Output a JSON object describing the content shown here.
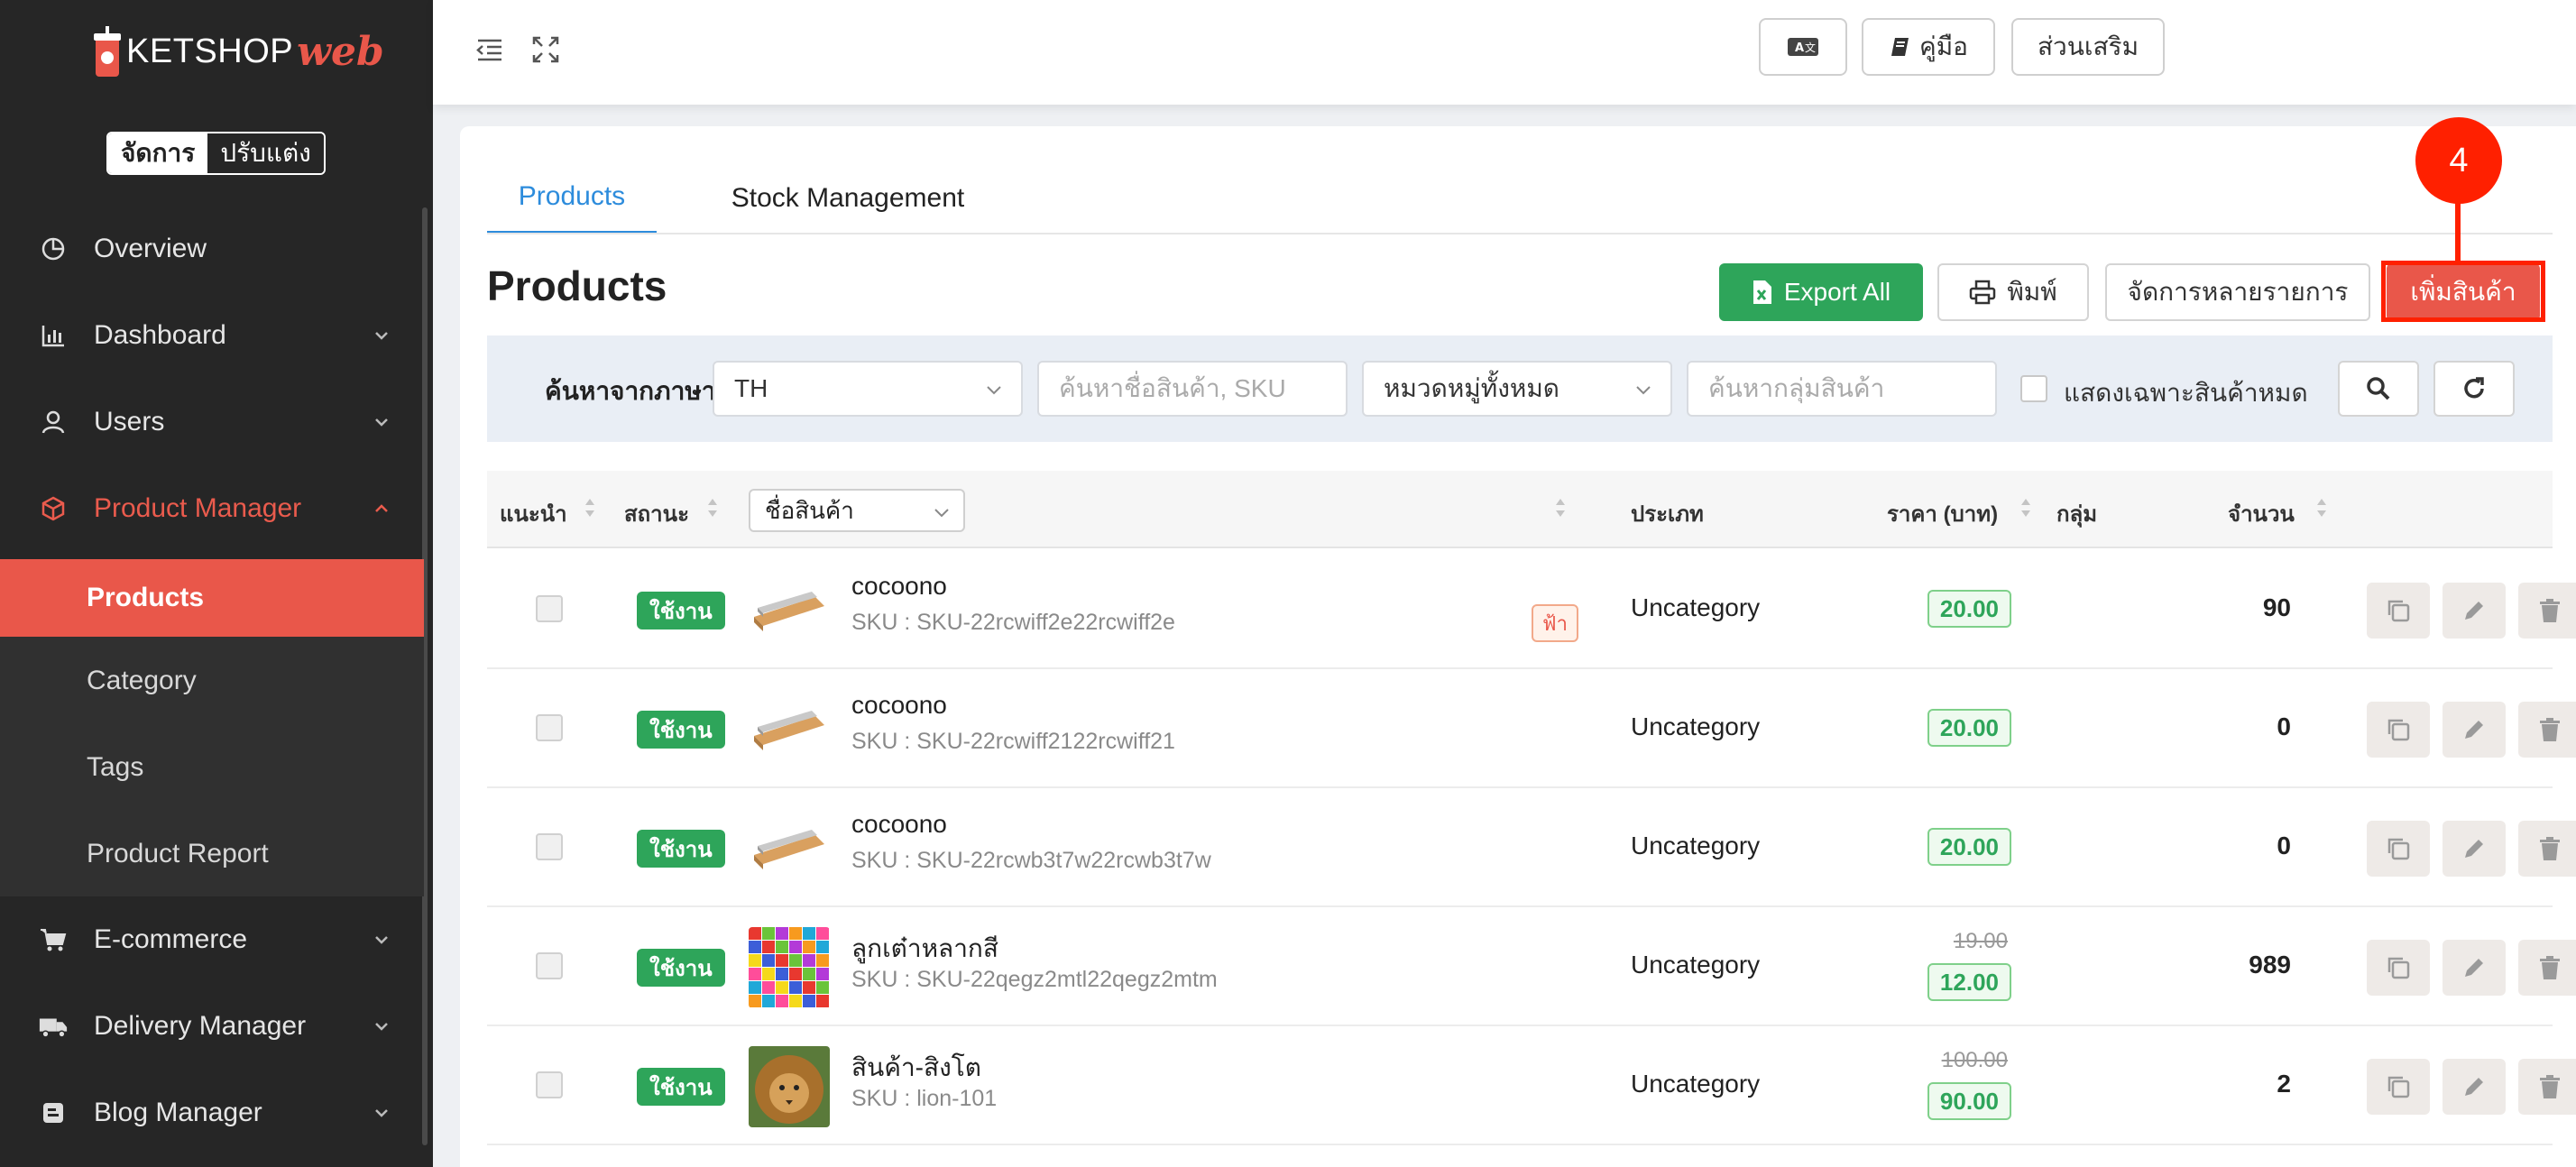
{
  "brand": {
    "name": "KETSHOP",
    "suffix": "web"
  },
  "mode": {
    "active": "จัดการ",
    "inactive": "ปรับแต่ง"
  },
  "nav": [
    {
      "label": "Overview",
      "icon": "pie-chart-icon"
    },
    {
      "label": "Dashboard",
      "icon": "bar-chart-icon"
    },
    {
      "label": "Users",
      "icon": "user-icon"
    },
    {
      "label": "Product Manager",
      "icon": "box-icon"
    },
    {
      "label": "E-commerce",
      "icon": "cart-icon"
    },
    {
      "label": "Delivery Manager",
      "icon": "truck-icon"
    },
    {
      "label": "Blog Manager",
      "icon": "blog-icon"
    }
  ],
  "subnav": [
    "Products",
    "Category",
    "Tags",
    "Product Report"
  ],
  "topbar": {
    "translate_icon": "translate-icon",
    "manual": "คู่มือ",
    "addons": "ส่วนเสริม"
  },
  "tabs": [
    "Products",
    "Stock Management"
  ],
  "page_title": "Products",
  "actions": {
    "export": "Export All",
    "print": "พิมพ์",
    "bulk": "จัดการหลายรายการ",
    "add": "เพิ่มสินค้า"
  },
  "step_badge": "4",
  "filter": {
    "label": "ค้นหาจากภาษา",
    "language": "TH",
    "search_placeholder": "ค้นหาชื่อสินค้า, SKU",
    "category": "หมวดหมู่ทั้งหมด",
    "group_placeholder": "ค้นหากลุ่มสินค้า",
    "out_of_stock": "แสดงเฉพาะสินค้าหมด"
  },
  "columns": {
    "recommend": "แนะนำ",
    "status": "สถานะ",
    "name": "ชื่อสินค้า",
    "type": "ประเภท",
    "price": "ราคา (บาท)",
    "group": "กลุ่ม",
    "qty": "จำนวน"
  },
  "rows": [
    {
      "status": "ใช้งาน",
      "name": "cocoono",
      "sku": "SKU : SKU-22rcwiff2e22rcwiff2e",
      "tag": "ฟ้า",
      "type": "Uncategory",
      "old_price": "",
      "price": "20.00",
      "qty": "90",
      "thumb": "wood"
    },
    {
      "status": "ใช้งาน",
      "name": "cocoono",
      "sku": "SKU : SKU-22rcwiff2122rcwiff21",
      "tag": "",
      "type": "Uncategory",
      "old_price": "",
      "price": "20.00",
      "qty": "0",
      "thumb": "wood"
    },
    {
      "status": "ใช้งาน",
      "name": "cocoono",
      "sku": "SKU : SKU-22rcwb3t7w22rcwb3t7w",
      "tag": "",
      "type": "Uncategory",
      "old_price": "",
      "price": "20.00",
      "qty": "0",
      "thumb": "wood"
    },
    {
      "status": "ใช้งาน",
      "name": "ลูกเต๋าหลากสี",
      "sku": "SKU : SKU-22qegz2mtl22qegz2mtm",
      "tag": "",
      "type": "Uncategory",
      "old_price": "19.00",
      "price": "12.00",
      "qty": "989",
      "thumb": "cubes"
    },
    {
      "status": "ใช้งาน",
      "name": "สินค้า-สิงโต",
      "sku": "SKU : lion-101",
      "tag": "",
      "type": "Uncategory",
      "old_price": "100.00",
      "price": "90.00",
      "qty": "2",
      "thumb": "lion"
    }
  ],
  "colors": {
    "accent": "#e9574a",
    "green": "#2ea55a",
    "blue": "#2d8cdc",
    "sidebar": "#262626"
  }
}
